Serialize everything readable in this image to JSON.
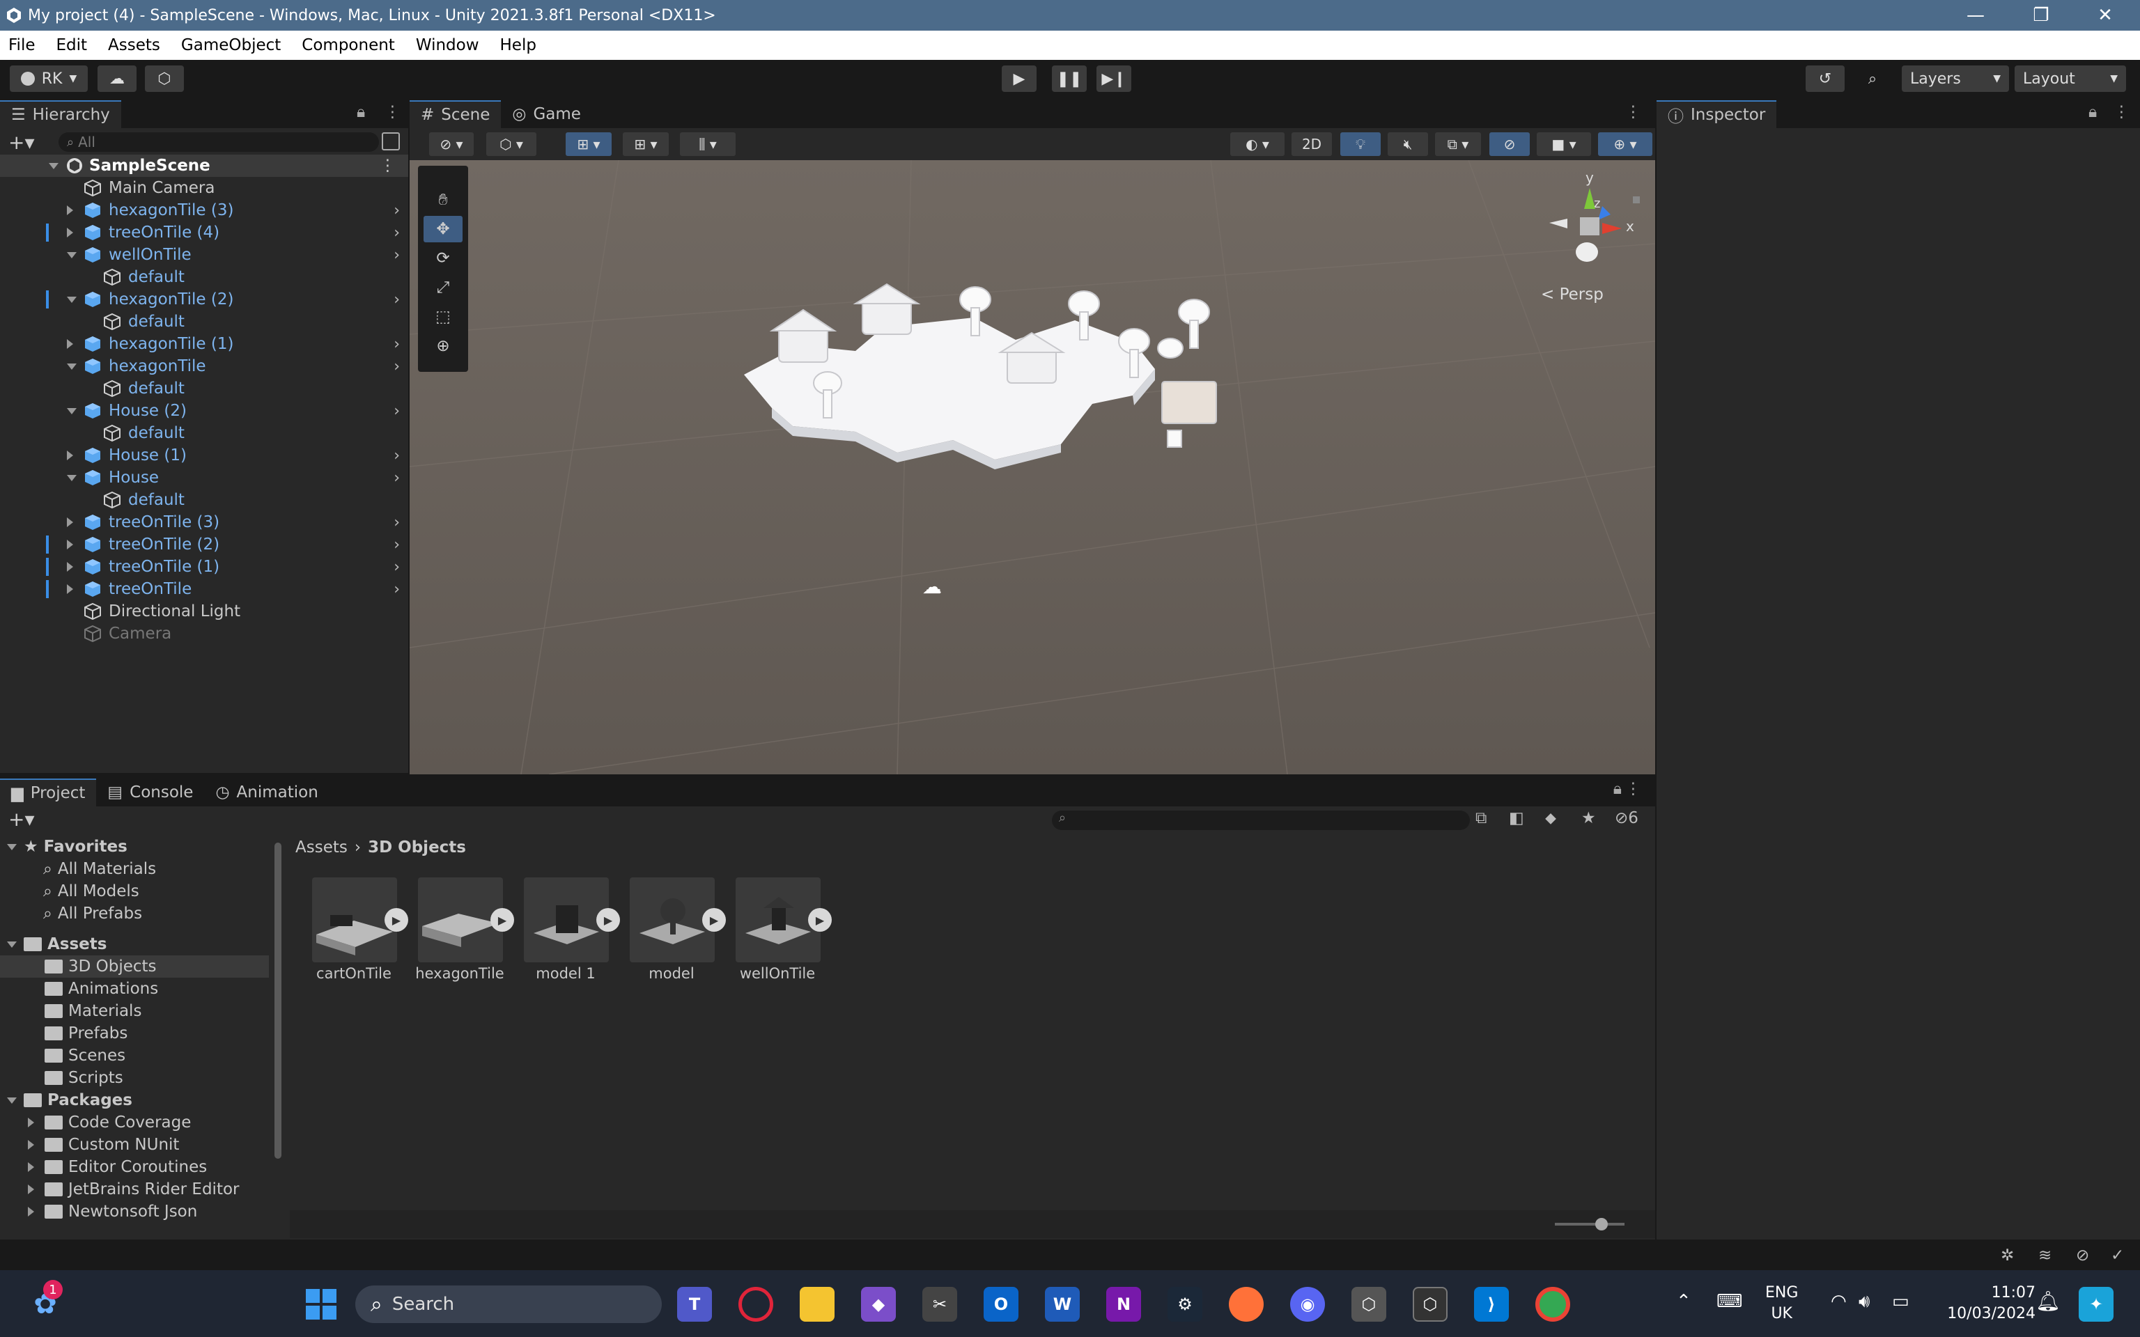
{
  "window": {
    "title": "My project (4) - SampleScene - Windows, Mac, Linux - Unity 2021.3.8f1 Personal <DX11>",
    "minimize": "—",
    "maximize": "❐",
    "close": "✕"
  },
  "menu": [
    "File",
    "Edit",
    "Assets",
    "GameObject",
    "Component",
    "Window",
    "Help"
  ],
  "toolbar": {
    "account": "RK",
    "layers": "Layers",
    "layout": "Layout"
  },
  "hierarchy": {
    "tab": "Hierarchy",
    "search_placeholder": "All",
    "scene": "SampleScene",
    "items": [
      {
        "label": "Main Camera"
      },
      {
        "label": "hexagonTile (3)"
      },
      {
        "label": "treeOnTile (4)"
      },
      {
        "label": "wellOnTile"
      },
      {
        "label": "default"
      },
      {
        "label": "hexagonTile (2)"
      },
      {
        "label": "default"
      },
      {
        "label": "hexagonTile (1)"
      },
      {
        "label": "hexagonTile"
      },
      {
        "label": "default"
      },
      {
        "label": "House (2)"
      },
      {
        "label": "default"
      },
      {
        "label": "House (1)"
      },
      {
        "label": "House"
      },
      {
        "label": "default"
      },
      {
        "label": "treeOnTile (3)"
      },
      {
        "label": "treeOnTile (2)"
      },
      {
        "label": "treeOnTile (1)"
      },
      {
        "label": "treeOnTile"
      },
      {
        "label": "Directional Light"
      },
      {
        "label": "Camera"
      }
    ]
  },
  "scene": {
    "tab_scene": "Scene",
    "tab_game": "Game",
    "btn_2d": "2D",
    "persp": "< Persp",
    "axis_y": "y",
    "axis_z": "z",
    "axis_x": "x"
  },
  "inspector": {
    "tab": "Inspector"
  },
  "project": {
    "tabs": [
      "Project",
      "Console",
      "Animation"
    ],
    "hidden_count": "6",
    "favorites": "Favorites",
    "fav_items": [
      "All Materials",
      "All Models",
      "All Prefabs"
    ],
    "assets": "Assets",
    "asset_folders": [
      "3D Objects",
      "Animations",
      "Materials",
      "Prefabs",
      "Scenes",
      "Scripts"
    ],
    "packages": "Packages",
    "package_folders": [
      "Code Coverage",
      "Custom NUnit",
      "Editor Coroutines",
      "JetBrains Rider Editor",
      "Newtonsoft Json"
    ],
    "breadcrumb_root": "Assets",
    "breadcrumb_current": "3D Objects",
    "files": [
      "cartOnTile",
      "hexagonTile",
      "model 1",
      "model",
      "wellOnTile"
    ]
  },
  "taskbar": {
    "search": "Search",
    "lang1": "ENG",
    "lang2": "UK",
    "time": "11:07",
    "date": "10/03/2024",
    "notif_count": "1"
  }
}
